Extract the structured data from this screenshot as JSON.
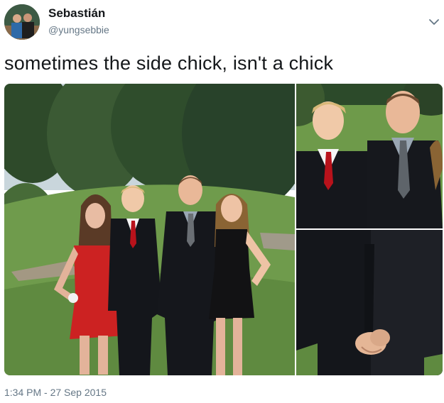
{
  "tweet": {
    "display_name": "Sebastián",
    "handle": "@yungsebbie",
    "text": "sometimes the side chick, isn't a chick",
    "timestamp": "1:34 PM - 27 Sep 2015",
    "menu_icon": "chevron-down-icon"
  },
  "media": {
    "photo_count": 3,
    "photos": [
      "group-photo",
      "crop-faces-photo",
      "crop-hands-photo"
    ]
  }
}
